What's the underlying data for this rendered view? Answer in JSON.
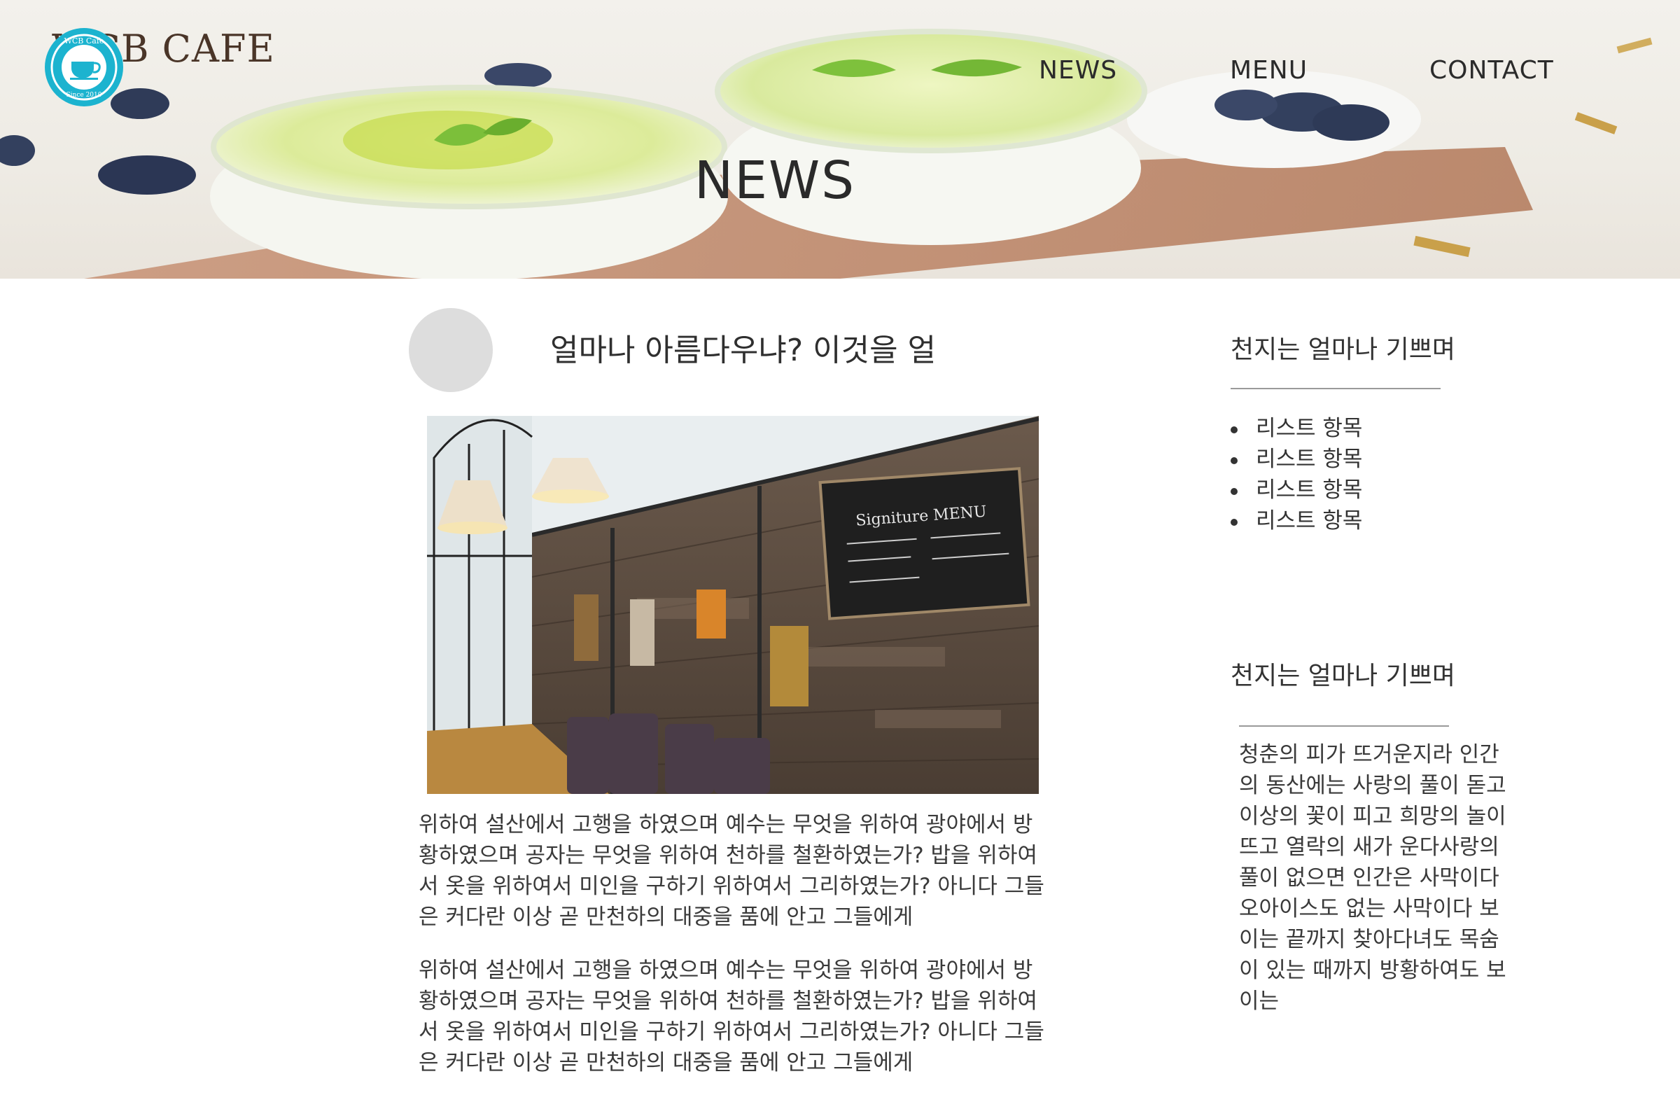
{
  "brand": {
    "name": "WCB CAFE",
    "badge_top": "WCB Cafe",
    "badge_bottom": "Since 2010"
  },
  "nav": {
    "items": [
      "NEWS",
      "MENU",
      "CONTACT"
    ]
  },
  "hero": {
    "title": "NEWS"
  },
  "article": {
    "title": "얼마나 아름다우냐? 이것을 얼",
    "paragraphs": [
      "위하여 설산에서 고행을 하였으며 예수는 무엇을 위하여 광야에서 방황하였으며 공자는 무엇을 위하여 천하를 철환하였는가? 밥을 위하여서 옷을 위하여서 미인을 구하기 위하여서 그리하였는가? 아니다 그들은 커다란 이상 곧 만천하의 대중을 품에 안고 그들에게",
      "위하여 설산에서 고행을 하였으며 예수는 무엇을 위하여 광야에서 방황하였으며 공자는 무엇을 위하여 천하를 철환하였는가? 밥을 위하여서 옷을 위하여서 미인을 구하기 위하여서 그리하였는가? 아니다 그들은 커다란 이상 곧 만천하의 대중을 품에 안고 그들에게"
    ],
    "photo_menu_board": "Signiture MENU"
  },
  "sidebar": {
    "section1_title": "천지는 얼마나 기쁘며",
    "list": [
      "리스트 항목",
      "리스트 항목",
      "리스트 항목",
      "리스트 항목"
    ],
    "section2_title": "천지는 얼마나 기쁘며",
    "section2_text": "청춘의 피가 뜨거운지라 인간의 동산에는 사랑의 풀이 돋고 이상의 꽃이 피고 희망의 놀이 뜨고 열락의 새가 운다사랑의 풀이 없으면 인간은 사막이다 오아이스도 없는 사막이다 보이는 끝까지 찾아다녀도 목숨이 있는 때까지 방황하여도 보이는"
  },
  "colors": {
    "logo_teal": "#1cb3cf",
    "logo_brown": "#4a3528",
    "text": "#333333"
  }
}
